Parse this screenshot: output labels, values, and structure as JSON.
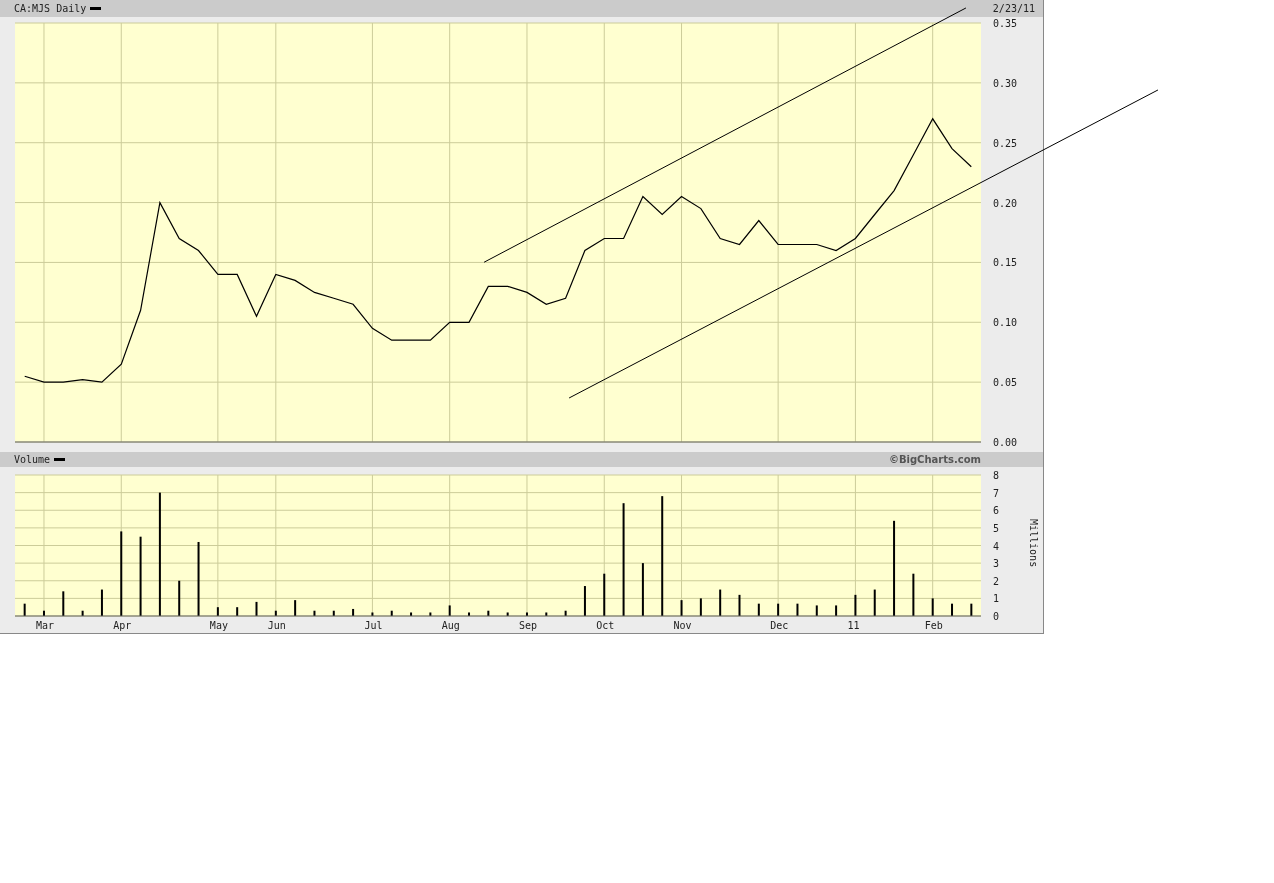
{
  "header": {
    "title": "CA:MJS Daily",
    "date": "2/23/11"
  },
  "price_chart": {
    "chart_data": {
      "type": "line",
      "grid": true,
      "ylim": [
        0,
        0.35
      ],
      "yticks": [
        {
          "value": 0,
          "label": "0.00"
        },
        {
          "value": 0.05,
          "label": "0.05"
        },
        {
          "value": 0.1,
          "label": "0.10"
        },
        {
          "value": 0.15,
          "label": "0.15"
        },
        {
          "value": 0.2,
          "label": "0.20"
        },
        {
          "value": 0.25,
          "label": "0.25"
        },
        {
          "value": 0.3,
          "label": "0.30"
        },
        {
          "value": 0.35,
          "label": "0.35"
        }
      ],
      "categories": [
        null,
        null,
        null,
        null,
        null,
        null,
        null,
        null,
        null,
        null,
        null,
        null,
        null,
        null,
        null,
        null,
        null,
        null,
        null,
        null,
        null,
        null,
        null,
        null,
        null,
        null,
        null,
        null,
        null,
        null,
        null,
        null,
        null,
        null,
        null,
        null,
        null,
        null,
        null,
        null,
        null,
        null,
        null,
        null,
        null,
        null,
        null,
        null,
        null,
        null
      ],
      "series": [
        {
          "color": "#000000",
          "values": [
            0.055,
            0.05,
            0.05,
            0.052,
            0.05,
            0.065,
            0.11,
            0.2,
            0.17,
            0.16,
            0.14,
            0.14,
            0.105,
            0.14,
            0.135,
            0.125,
            0.12,
            0.115,
            0.095,
            0.085,
            0.085,
            0.085,
            0.1,
            0.1,
            0.13,
            0.13,
            0.125,
            0.115,
            0.12,
            0.16,
            0.17,
            0.17,
            0.205,
            0.19,
            0.205,
            0.195,
            0.17,
            0.165,
            0.185,
            0.165,
            0.165,
            0.165,
            0.16,
            0.17,
            0.19,
            0.21,
            0.24,
            0.27,
            0.245,
            0.23
          ]
        }
      ]
    }
  },
  "volume_header": {
    "title": "Volume",
    "credit": "©BigCharts.com"
  },
  "volume_chart": {
    "chart_data": {
      "type": "bar",
      "grid": true,
      "ylabel": "Millions",
      "ylim": [
        0,
        8
      ],
      "categories": [
        null,
        "Mar",
        null,
        null,
        null,
        "Apr",
        null,
        null,
        null,
        null,
        "May",
        null,
        null,
        "Jun",
        null,
        null,
        null,
        null,
        "Jul",
        null,
        null,
        null,
        "Aug",
        null,
        null,
        null,
        "Sep",
        null,
        null,
        null,
        "Oct",
        null,
        null,
        null,
        "Nov",
        null,
        null,
        null,
        null,
        "Dec",
        null,
        null,
        null,
        "11",
        null,
        null,
        null,
        "Feb",
        null,
        null
      ],
      "yticks": [
        0,
        1,
        2,
        3,
        4,
        5,
        6,
        7,
        8
      ],
      "series": [
        {
          "color": "#000000",
          "values": [
            0.7,
            0.3,
            1.4,
            0.3,
            1.5,
            4.8,
            4.5,
            7,
            2,
            4.2,
            0.5,
            0.5,
            0.8,
            0.3,
            0.9,
            0.3,
            0.3,
            0.4,
            0.2,
            0.3,
            0.2,
            0.2,
            0.6,
            0.2,
            0.3,
            0.2,
            0.2,
            0.2,
            0.3,
            1.7,
            2.4,
            6.4,
            3,
            6.8,
            0.9,
            1,
            1.5,
            1.2,
            0.7,
            0.7,
            0.7,
            0.6,
            0.6,
            1.2,
            1.5,
            5.4,
            2.4,
            1,
            0.7,
            0.7
          ]
        }
      ]
    }
  }
}
